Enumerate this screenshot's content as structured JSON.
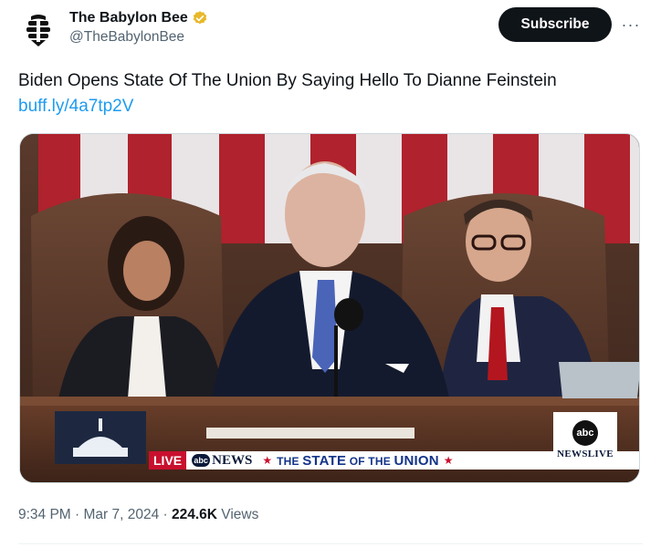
{
  "author": {
    "display_name": "The Babylon Bee",
    "handle": "@TheBabylonBee",
    "avatar_icon": "bee-logo-icon",
    "verified_icon": "gold-verified-badge-icon",
    "verified_color": "#e8b829"
  },
  "actions": {
    "subscribe_label": "Subscribe",
    "more_label": "···"
  },
  "tweet": {
    "text": "Biden Opens State Of The Union By Saying Hello To Dianne Feinstein",
    "link": "buff.ly/4a7tp2V",
    "link_color": "#1d9bf0"
  },
  "media": {
    "lower_third": {
      "live": "LIVE",
      "abc_badge": "abc",
      "news": "NEWS",
      "star": "★",
      "title_part1": "THE ",
      "title_part2": "STATE",
      "title_part3": " OF THE ",
      "title_part4": "UNION"
    },
    "corner_logo": {
      "abc": "abc",
      "label": "NEWSLIVE"
    }
  },
  "meta": {
    "time": "9:34 PM",
    "sep1": " · ",
    "date": "Mar 7, 2024",
    "sep2": " · ",
    "views_count": "224.6K",
    "views_label": " Views"
  }
}
